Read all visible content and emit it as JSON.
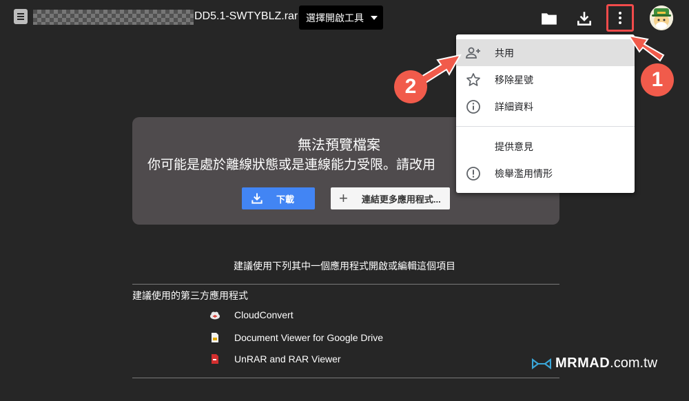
{
  "header": {
    "filename": "DD5.1-SWTYBLZ.rar",
    "open_with_label": "選擇開啟工具"
  },
  "preview": {
    "title": "無法預覽檔案",
    "message": "你可能是處於離線狀態或是連線能力受限。請改用",
    "download_label": "下載",
    "connect_label": "連結更多應用程式..."
  },
  "suggestions": {
    "heading": "建議使用下列其中一個應用程式開啟或編輯這個項目",
    "third_party_label": "建議使用的第三方應用程式",
    "apps": [
      {
        "name": "CloudConvert",
        "icon": "cloud-convert-icon"
      },
      {
        "name": "Document Viewer for Google Drive",
        "icon": "document-viewer-icon"
      },
      {
        "name": "UnRAR and RAR Viewer",
        "icon": "unrar-icon"
      }
    ]
  },
  "menu": {
    "items": [
      {
        "label": "共用",
        "icon": "add-person-icon"
      },
      {
        "label": "移除星號",
        "icon": "star-outline-icon"
      },
      {
        "label": "詳細資料",
        "icon": "info-icon"
      },
      {
        "label": "提供意見",
        "icon": ""
      },
      {
        "label": "檢舉濫用情形",
        "icon": "report-icon"
      }
    ]
  },
  "annotations": {
    "step1": "1",
    "step2": "2"
  },
  "watermark": {
    "brand": "MRMAD",
    "domain": ".com.tw"
  },
  "colors": {
    "background": "#262626",
    "accent_blue": "#4285f4",
    "annotation_red": "#f15b4b"
  }
}
